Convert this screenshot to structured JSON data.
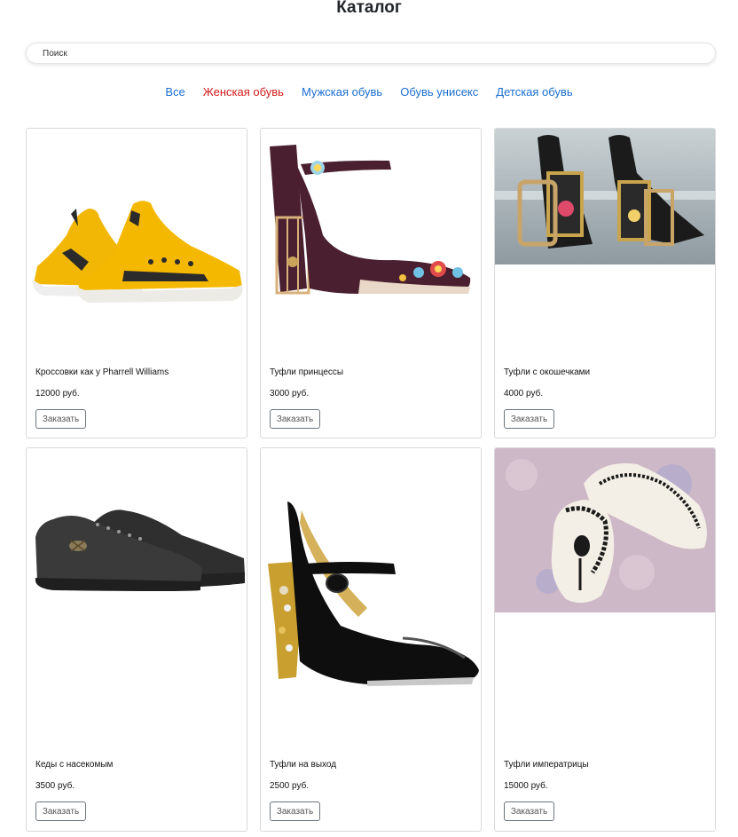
{
  "header": {
    "title": "Каталог"
  },
  "search": {
    "placeholder": "Поиск"
  },
  "nav": {
    "items": [
      {
        "label": "Все",
        "active": false
      },
      {
        "label": "Женская обувь",
        "active": true
      },
      {
        "label": "Мужская обувь",
        "active": false
      },
      {
        "label": "Обувь унисекс",
        "active": false
      },
      {
        "label": "Детская обувь",
        "active": false
      }
    ],
    "colors": {
      "link": "#1a6fd1",
      "active": "#d11a1a"
    }
  },
  "products": [
    {
      "name": "Кроссовки как у Pharrell Williams",
      "price": "12000 руб.",
      "button": "Заказать",
      "image": "yellow-sneakers-image"
    },
    {
      "name": "Туфли принцессы",
      "price": "3000 руб.",
      "button": "Заказать",
      "image": "burgundy-heels-image"
    },
    {
      "name": "Туфли с окошечками",
      "price": "4000 руб.",
      "button": "Заказать",
      "image": "black-ornate-heels-image"
    },
    {
      "name": "Кеды с насекомым",
      "price": "3500 руб.",
      "button": "Заказать",
      "image": "black-sneakers-image"
    },
    {
      "name": "Туфли на выход",
      "price": "2500 руб.",
      "button": "Заказать",
      "image": "black-patent-heels-image"
    },
    {
      "name": "Туфли императрицы",
      "price": "15000 руб.",
      "button": "Заказать",
      "image": "white-lace-slippers-image"
    }
  ]
}
